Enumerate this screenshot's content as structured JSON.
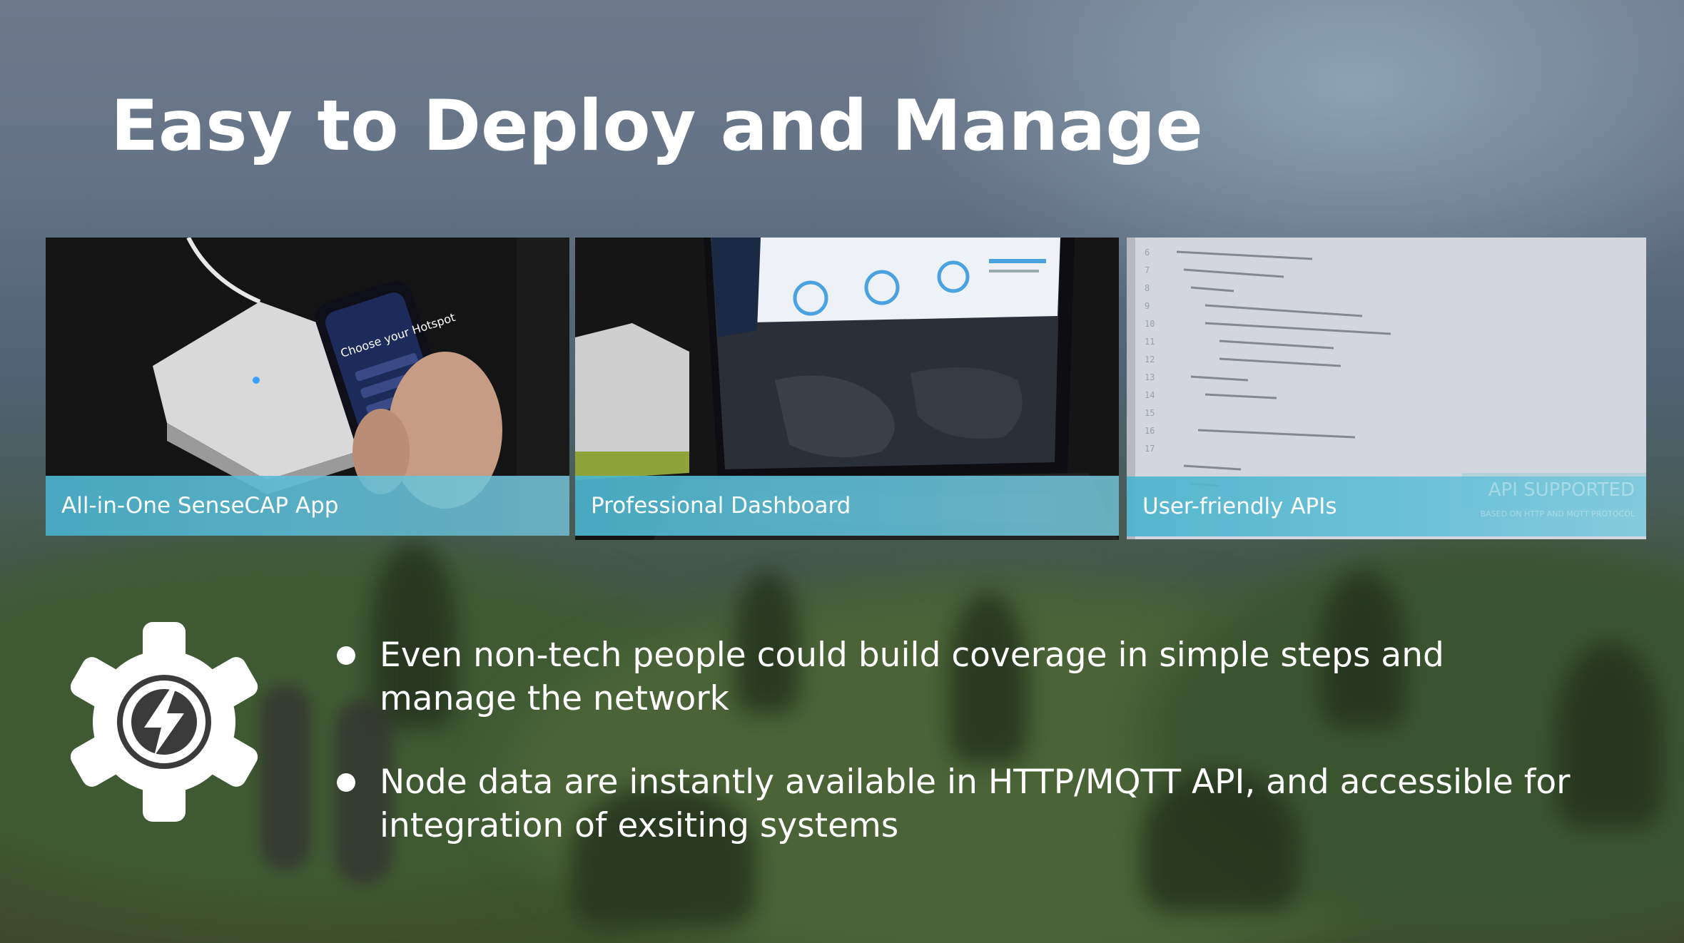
{
  "slide": {
    "title": "Easy to Deploy and Manage"
  },
  "panels": [
    {
      "caption": "All-in-One SenseCAP App",
      "phone_text": "Choose your Hotspot"
    },
    {
      "caption": "Professional Dashboard"
    },
    {
      "caption": "User-friendly APIs",
      "overlay_text": "API SUPPORTED",
      "overlay_subtext": "BASED ON HTTP AND MQTT PROTOCOL"
    }
  ],
  "bullets": [
    "Even non-tech people could build coverage in simple steps and manage the network",
    "Node data are instantly available in HTTP/MQTT API, and accessible for integration of exsiting systems"
  ],
  "icons": {
    "feature_icon": "gear-lightning-icon"
  },
  "colors": {
    "caption_bar": "#4cb4cd",
    "text": "#ffffff"
  }
}
